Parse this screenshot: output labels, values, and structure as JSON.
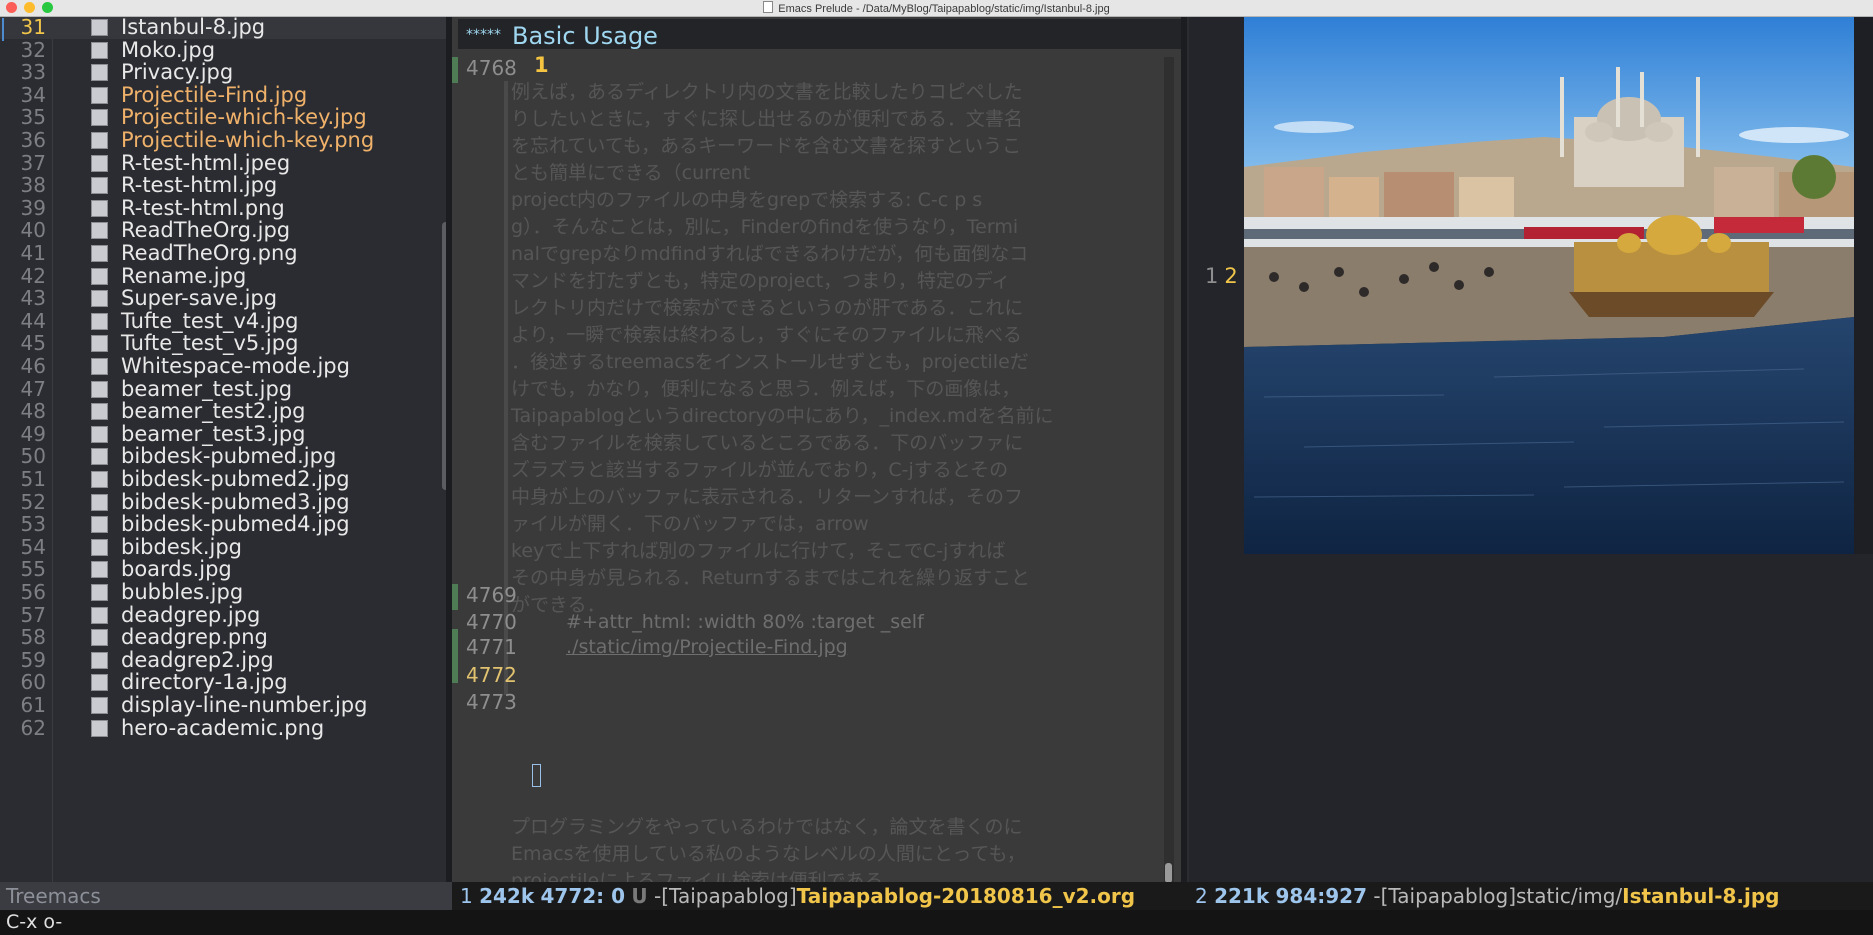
{
  "window": {
    "title": "Emacs Prelude - /Data/MyBlog/Taipapablog/static/img/Istanbul-8.jpg"
  },
  "treemacs": {
    "rows": [
      {
        "num": "31",
        "name": "Istanbul-8.jpg"
      },
      {
        "num": "32",
        "name": "Moko.jpg"
      },
      {
        "num": "33",
        "name": "Privacy.jpg"
      },
      {
        "num": "34",
        "name": "Projectile-Find.jpg"
      },
      {
        "num": "35",
        "name": "Projectile-which-key.jpg"
      },
      {
        "num": "36",
        "name": "Projectile-which-key.png"
      },
      {
        "num": "37",
        "name": "R-test-html.jpeg"
      },
      {
        "num": "38",
        "name": "R-test-html.jpg"
      },
      {
        "num": "39",
        "name": "R-test-html.png"
      },
      {
        "num": "40",
        "name": "ReadTheOrg.jpg"
      },
      {
        "num": "41",
        "name": "ReadTheOrg.png"
      },
      {
        "num": "42",
        "name": "Rename.jpg"
      },
      {
        "num": "43",
        "name": "Super-save.jpg"
      },
      {
        "num": "44",
        "name": "Tufte_test_v4.jpg"
      },
      {
        "num": "45",
        "name": "Tufte_test_v5.jpg"
      },
      {
        "num": "46",
        "name": "Whitespace-mode.jpg"
      },
      {
        "num": "47",
        "name": "beamer_test.jpg"
      },
      {
        "num": "48",
        "name": "beamer_test2.jpg"
      },
      {
        "num": "49",
        "name": "beamer_test3.jpg"
      },
      {
        "num": "50",
        "name": "bibdesk-pubmed.jpg"
      },
      {
        "num": "51",
        "name": "bibdesk-pubmed2.jpg"
      },
      {
        "num": "52",
        "name": "bibdesk-pubmed3.jpg"
      },
      {
        "num": "53",
        "name": "bibdesk-pubmed4.jpg"
      },
      {
        "num": "54",
        "name": "bibdesk.jpg"
      },
      {
        "num": "55",
        "name": "boards.jpg"
      },
      {
        "num": "56",
        "name": "bubbles.jpg"
      },
      {
        "num": "57",
        "name": "deadgrep.jpg"
      },
      {
        "num": "58",
        "name": "deadgrep.png"
      },
      {
        "num": "59",
        "name": "deadgrep2.jpg"
      },
      {
        "num": "60",
        "name": "directory-1a.jpg"
      },
      {
        "num": "61",
        "name": "display-line-number.jpg"
      },
      {
        "num": "62",
        "name": "hero-academic.png"
      }
    ]
  },
  "editor": {
    "heading_stars": "*****",
    "heading": "Basic Usage",
    "line_4768": "4768",
    "marker_1": "1",
    "paragraph": [
      "例えば，あるディレクトリ内の文書を比較したりコピペした",
      "りしたいときに，すぐに探し出せるのが便利である．文書名",
      "を忘れていても，あるキーワードを含む文書を探すというこ",
      "とも簡単にできる（current",
      "project内のファイルの中身をgrepで検索する: C-c p s",
      "g）．そんなことは，別に，Finderのfindを使うなり，Termi",
      "nalでgrepなりmdfindすればできるわけだが，何も面倒なコ",
      "マンドを打たずとも，特定のproject，つまり，特定のディ",
      "レクトリ内だけで検索ができるというのが肝である．これに",
      "より，一瞬で検索は終わるし，すぐにそのファイルに飛べる",
      "．後述するtreemacsをインストールせずとも，projectileだ",
      "けでも，かなり，便利になると思う．例えば，下の画像は，",
      "Taipapablogというdirectoryの中にあり，_index.mdを名前に",
      "含むファイルを検索しているところである．下のバッファに",
      "ズラズラと該当するファイルが並んでおり，C-jするとその",
      "中身が上のバッファに表示される．リターンすれば，そのフ",
      "ァイルが開く．下のバッファでは，arrow",
      "keyで上下すれば別のファイルに行けて，そこでC-jすれば",
      "その中身が見られる．Returnするまではこれを繰り返すこと",
      "ができる．"
    ],
    "lines": [
      {
        "num": "4769",
        "text": ""
      },
      {
        "num": "4770",
        "text": "#+attr_html: :width 80% :target _self"
      },
      {
        "num": "4771",
        "text": "./static/img/Projectile-Find.jpg"
      },
      {
        "num": "4772",
        "text": ""
      },
      {
        "num": "4773",
        "text": ""
      }
    ],
    "lower_paragraph": [
      "プログラミングをやっているわけではなく，論文を書くのに",
      "Emacsを使用している私のようなレベルの人間にとっても，",
      "projectileによるファイル検索は便利である。"
    ]
  },
  "image_pane": {
    "line_num_1": "1",
    "line_num_2": "2"
  },
  "modeline_left": {
    "label": "Treemacs"
  },
  "modeline_mid": {
    "window_num": "1",
    "size": "242k",
    "position": "4772: 0",
    "state": "U",
    "dash": "-",
    "project": "[Taipapablog]",
    "file": "Taipapablog-20180816_v2.org"
  },
  "modeline_right": {
    "window_num": "2",
    "size": "221k",
    "position": "984:927",
    "dash": "-",
    "project": "[Taipapablog]",
    "path": "static/img/",
    "file": "Istanbul-8.jpg"
  },
  "minibuffer": {
    "text": "C-x o-"
  },
  "colors": {
    "accent_yellow": "#f0c54a",
    "heading_cyan": "#9fd7f0",
    "highlight_orange": "#f0b26a"
  }
}
